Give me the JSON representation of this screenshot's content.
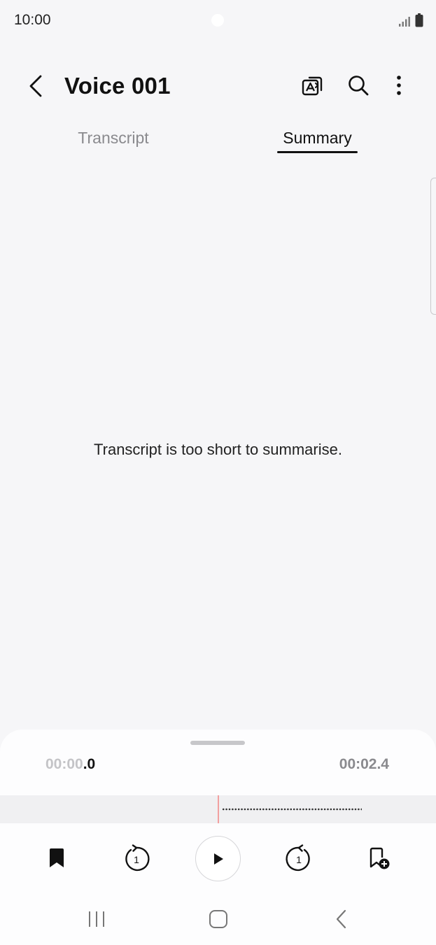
{
  "status": {
    "time": "10:00"
  },
  "header": {
    "title": "Voice 001"
  },
  "tabs": [
    {
      "label": "Transcript",
      "active": false
    },
    {
      "label": "Summary",
      "active": true
    }
  ],
  "main": {
    "message": "Transcript is too short to summarise."
  },
  "player": {
    "current_time_dim": "00:00",
    "current_time_bright": ".0",
    "total_time": "00:02.4",
    "skip_back_seconds": "1",
    "skip_forward_seconds": "1"
  },
  "icons": {
    "back": "back-arrow-icon",
    "translate": "translate-icon",
    "search": "search-icon",
    "more": "more-options-icon",
    "bookmark": "bookmark-icon",
    "rewind": "rewind-icon",
    "play": "play-icon",
    "forward": "forward-icon",
    "add_bookmark": "add-bookmark-icon"
  },
  "colors": {
    "background": "#f6f6f8",
    "playhead": "#f2a0a0",
    "accent": "#111111"
  }
}
